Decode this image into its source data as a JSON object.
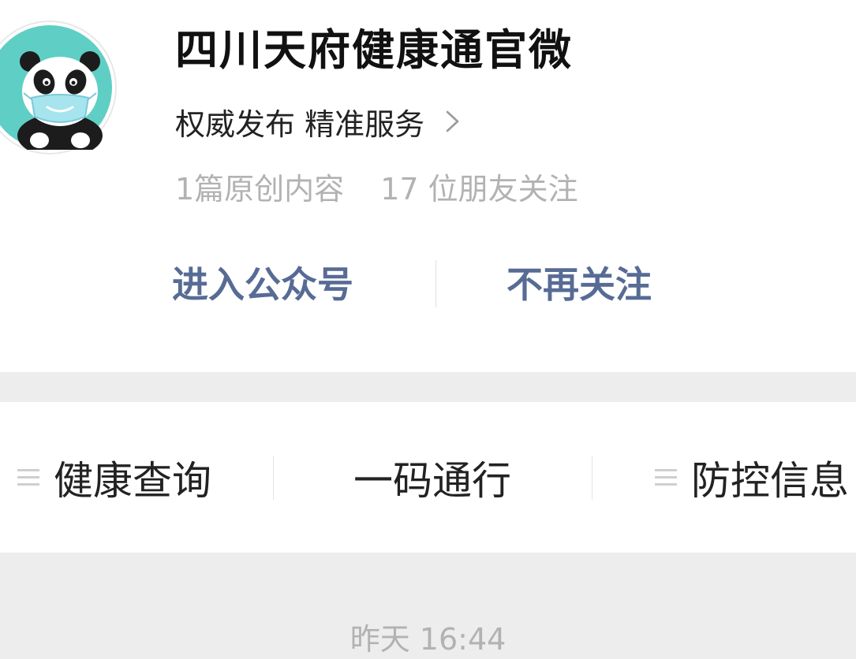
{
  "account": {
    "name": "四川天府健康通官微",
    "intro": "权威发布 精准服务",
    "stats": {
      "original_articles": "1篇原创内容",
      "friends_following": "17 位朋友关注"
    },
    "avatar_icon": "panda-with-mask-icon"
  },
  "actions": {
    "enter_label": "进入公众号",
    "unfollow_label": "不再关注"
  },
  "menu": {
    "items": [
      {
        "label": "健康查询",
        "icon": "menu-lines-icon"
      },
      {
        "label": "一码通行"
      },
      {
        "label": "防控信息",
        "icon": "menu-lines-icon"
      }
    ]
  },
  "feed": {
    "timestamp": "昨天 16:44"
  },
  "colors": {
    "link": "#576b95",
    "avatar_bg": "#5fcfc5",
    "secondary_text": "#b2b2b2",
    "page_bg": "#ededed"
  }
}
